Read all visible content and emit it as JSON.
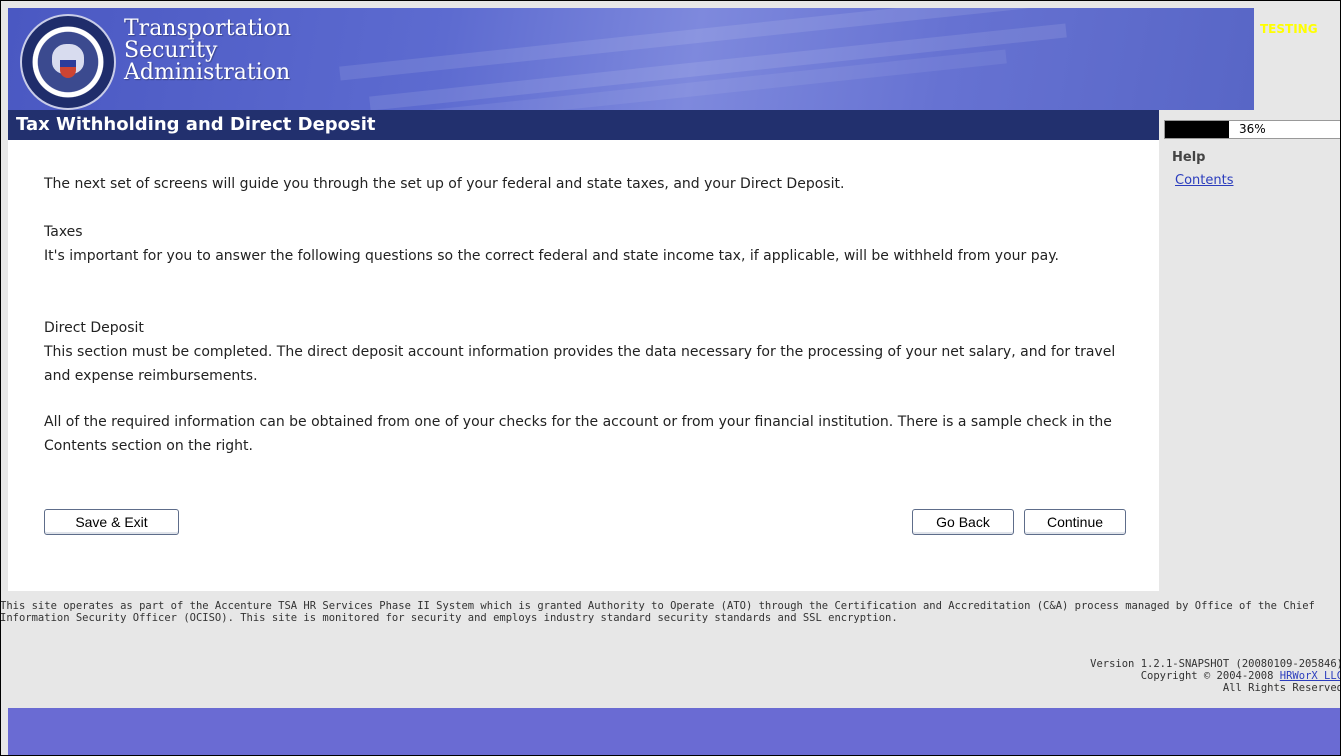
{
  "header": {
    "org_line1": "Transportation",
    "org_line2": "Security",
    "org_line3": "Administration",
    "testing_label": "TESTING"
  },
  "title_bar": {
    "title": "Tax Withholding and Direct Deposit",
    "progress_text": "36%",
    "progress_value": 0.36
  },
  "content": {
    "intro": "The next set of screens will guide you through the set up of your federal and state taxes, and your Direct Deposit.",
    "taxes_heading": "Taxes",
    "taxes_body": "It's important for you to answer the following questions so the correct federal and state income tax, if applicable, will be withheld from your pay.",
    "deposit_heading": "Direct Deposit",
    "deposit_body": "This section must be completed. The direct deposit account information provides the data necessary for the processing of your net salary, and for travel and expense reimbursements.",
    "required_info": "All of the required information can be obtained from one of your checks for the account or from your financial institution. There is a sample check in the Contents section on the right."
  },
  "buttons": {
    "save_exit": "Save & Exit",
    "go_back": "Go Back",
    "continue": "Continue"
  },
  "help": {
    "title": "Help",
    "contents_link": "Contents"
  },
  "footer": {
    "note": "This site operates as part of the Accenture TSA HR Services Phase II System which is granted Authority to Operate (ATO) through the Certification and Accreditation (C&A) process managed by Office of the Chief Information Security Officer (OCISO). This site is monitored for security and employs industry standard security standards and SSL encryption.",
    "version": "Version 1.2.1-SNAPSHOT (20080109-205846)",
    "copyright_prefix": "Copyright © 2004-2008 ",
    "company_link": "HRWorX LLC",
    "rights": "All Rights Reserved"
  },
  "colors": {
    "banner": "#5d6bd0",
    "title_bar": "#22306e",
    "bottom_bar": "#6a6bd3",
    "testing": "#ffff00",
    "link": "#2b3dbd"
  }
}
